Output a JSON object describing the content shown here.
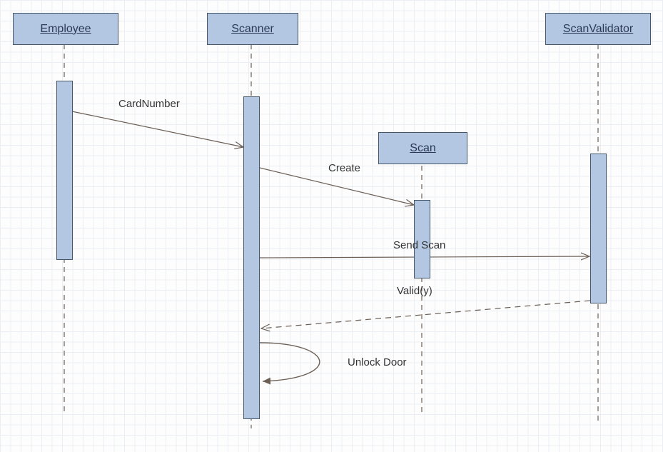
{
  "diagram": {
    "type": "sequence",
    "participants": {
      "employee": "Employee",
      "scanner": "Scanner",
      "scan": "Scan",
      "scanValidator": "ScanValidator"
    },
    "messages": {
      "cardNumber": "CardNumber",
      "create": "Create",
      "sendScan": "Send Scan",
      "valid": "Valid(y)",
      "unlockDoor": "Unlock Door"
    }
  }
}
